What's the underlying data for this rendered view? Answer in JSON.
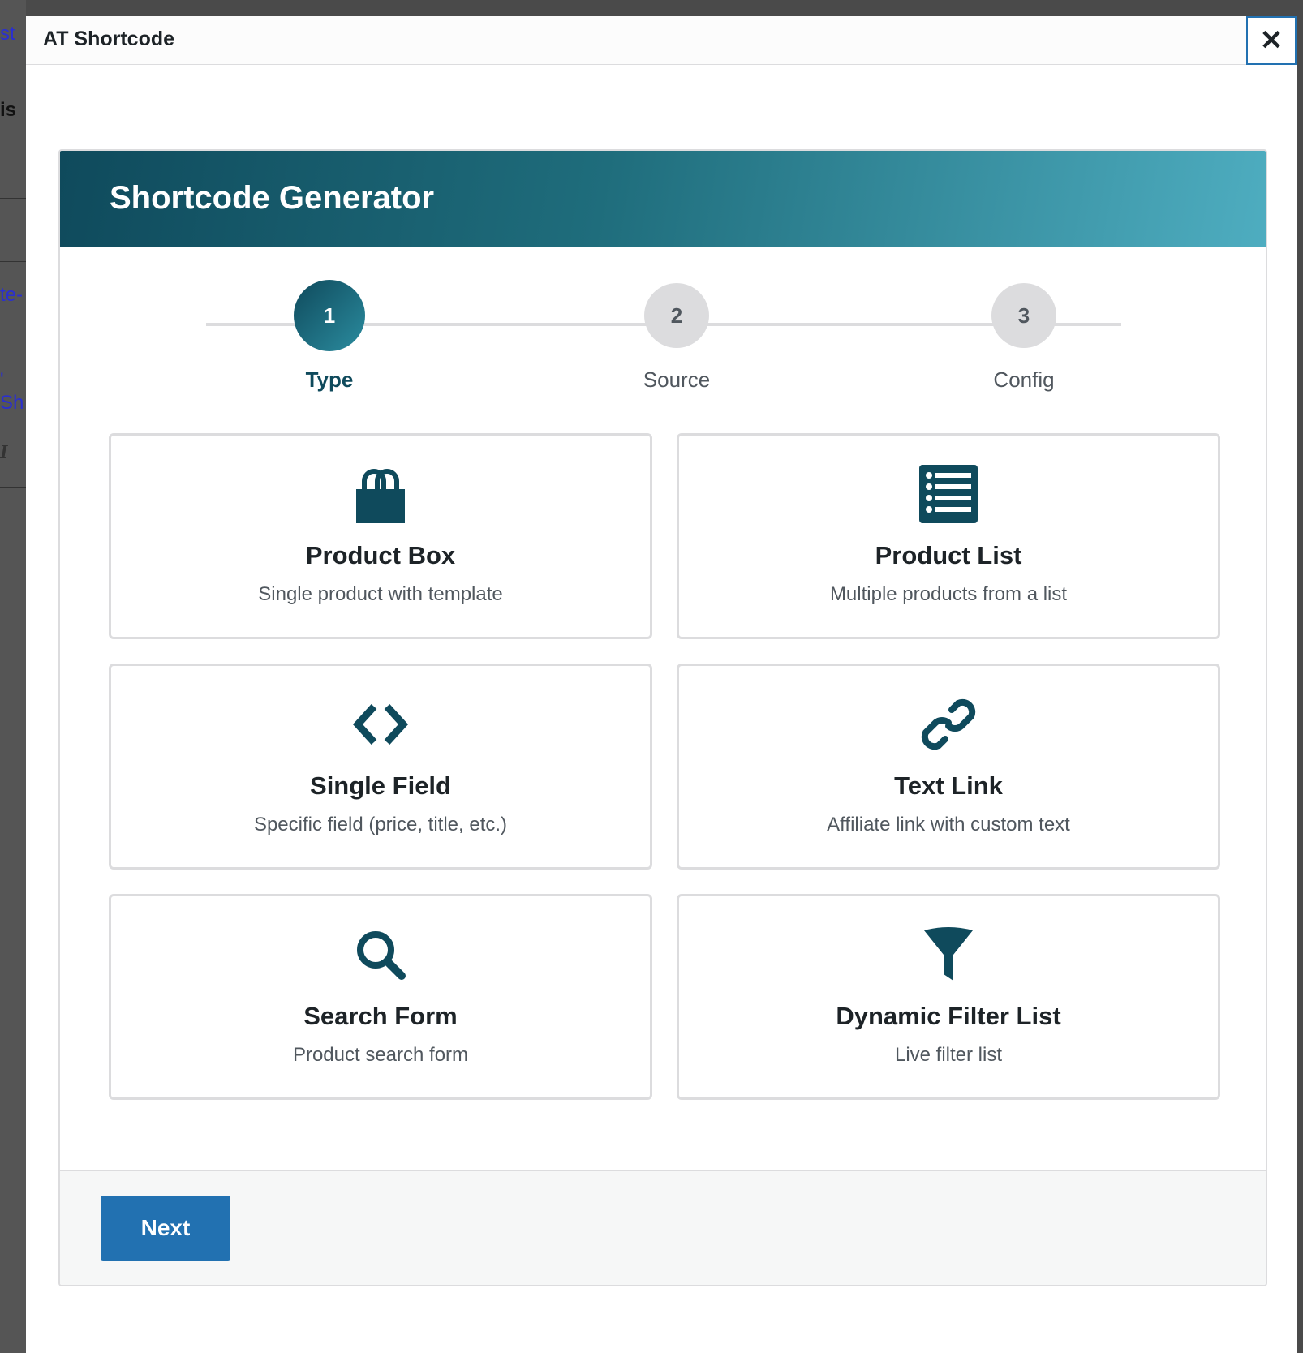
{
  "modal": {
    "title": "AT Shortcode",
    "close_symbol": "✕"
  },
  "background_fragments": [
    "st",
    "is",
    "te-",
    "' Sh",
    "I"
  ],
  "generator": {
    "title": "Shortcode Generator",
    "steps": [
      {
        "number": "1",
        "label": "Type",
        "active": true
      },
      {
        "number": "2",
        "label": "Source",
        "active": false
      },
      {
        "number": "3",
        "label": "Config",
        "active": false
      }
    ],
    "cards": [
      {
        "icon": "shopping-bag-icon",
        "title": "Product Box",
        "desc": "Single product with template"
      },
      {
        "icon": "list-icon",
        "title": "Product List",
        "desc": "Multiple products from a list"
      },
      {
        "icon": "code-icon",
        "title": "Single Field",
        "desc": "Specific field (price, title, etc.)"
      },
      {
        "icon": "link-icon",
        "title": "Text Link",
        "desc": "Affiliate link with custom text"
      },
      {
        "icon": "search-icon",
        "title": "Search Form",
        "desc": "Product search form"
      },
      {
        "icon": "filter-icon",
        "title": "Dynamic Filter List",
        "desc": "Live filter list"
      }
    ],
    "next_label": "Next"
  },
  "colors": {
    "accent": "#0f4a5c",
    "button": "#2271b1",
    "gradient_end": "#4eadc0"
  }
}
